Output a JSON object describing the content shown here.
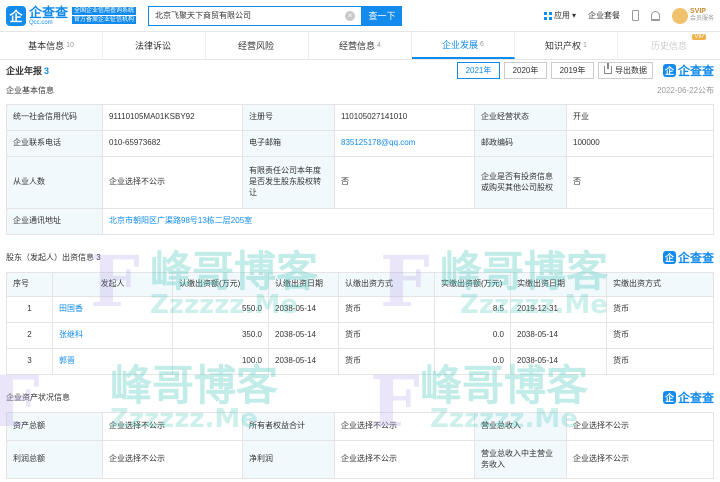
{
  "header": {
    "logo_mark": "企",
    "logo_name": "企查查",
    "logo_domain": "Qcc.com",
    "slogan_line1": "全国企业信用查询系统",
    "slogan_line2": "官方备案企业征信机构",
    "search_value": "北京飞聚天下商贸有限公司",
    "search_button": "查一下",
    "app_label": "应用",
    "enterprise_suite": "企业套餐",
    "vip_label": "SVIP",
    "vip_sub": "会员服务"
  },
  "tabs": [
    {
      "label": "基本信息",
      "count": "10"
    },
    {
      "label": "法律诉讼",
      "count": ""
    },
    {
      "label": "经营风险",
      "count": ""
    },
    {
      "label": "经营信息",
      "count": "4"
    },
    {
      "label": "企业发展",
      "count": "6"
    },
    {
      "label": "知识产权",
      "count": "1"
    },
    {
      "label": "历史信息",
      "count": "",
      "badge": "VIP"
    }
  ],
  "annual_report": {
    "title": "企业年报",
    "count": "3",
    "years": [
      "2021年",
      "2020年",
      "2019年"
    ],
    "export_label": "导出数据",
    "brand": "企查查",
    "basic_info_title": "企业基本信息",
    "published": "2022-06-22公布",
    "rows": [
      [
        "统一社会信用代码",
        "91110105MA01KSBY92",
        "注册号",
        "110105027141010",
        "企业经营状态",
        "开业"
      ],
      [
        "企业联系电话",
        "010-65973682",
        "电子邮箱",
        "835125178@qq.com",
        "邮政编码",
        "100000"
      ],
      [
        "从业人数",
        "企业选择不公示",
        "有限责任公司本年度是否发生股东股权转让",
        "否",
        "企业是否有投资信息或购买其他公司股权",
        "否"
      ]
    ],
    "address_label": "企业通讯地址",
    "address_value": "北京市朝阳区广渠路98号13栋二层205室"
  },
  "contributions": {
    "title": "股东（发起人）出资信息",
    "count": "3",
    "brand": "企查查",
    "headers": [
      "序号",
      "发起人",
      "认缴出资额(万元)",
      "认缴出资日期",
      "认缴出资方式",
      "实缴出资额(万元)",
      "实缴出资日期",
      "实缴出资方式"
    ],
    "rows": [
      [
        "1",
        "田国香",
        "550.0",
        "2038-05-14",
        "货币",
        "8.5",
        "2019-12-31",
        "货币"
      ],
      [
        "2",
        "张继科",
        "350.0",
        "2038-05-14",
        "货币",
        "0.0",
        "2038-05-14",
        "货币"
      ],
      [
        "3",
        "郭晋",
        "100.0",
        "2038-05-14",
        "货币",
        "0.0",
        "2038-05-14",
        "货币"
      ]
    ]
  },
  "assets": {
    "title": "企业资产状况信息",
    "brand": "企查查",
    "rows": [
      [
        "资产总额",
        "企业选择不公示",
        "所有者权益合计",
        "企业选择不公示",
        "营业总收入",
        "企业选择不公示"
      ],
      [
        "利润总额",
        "企业选择不公示",
        "净利润",
        "企业选择不公示",
        "营业总收入中主营业务收入",
        "企业选择不公示"
      ]
    ]
  },
  "watermark": {
    "text": "峰哥博客",
    "url": "Zzzzzz.Me",
    "letter": "F"
  }
}
